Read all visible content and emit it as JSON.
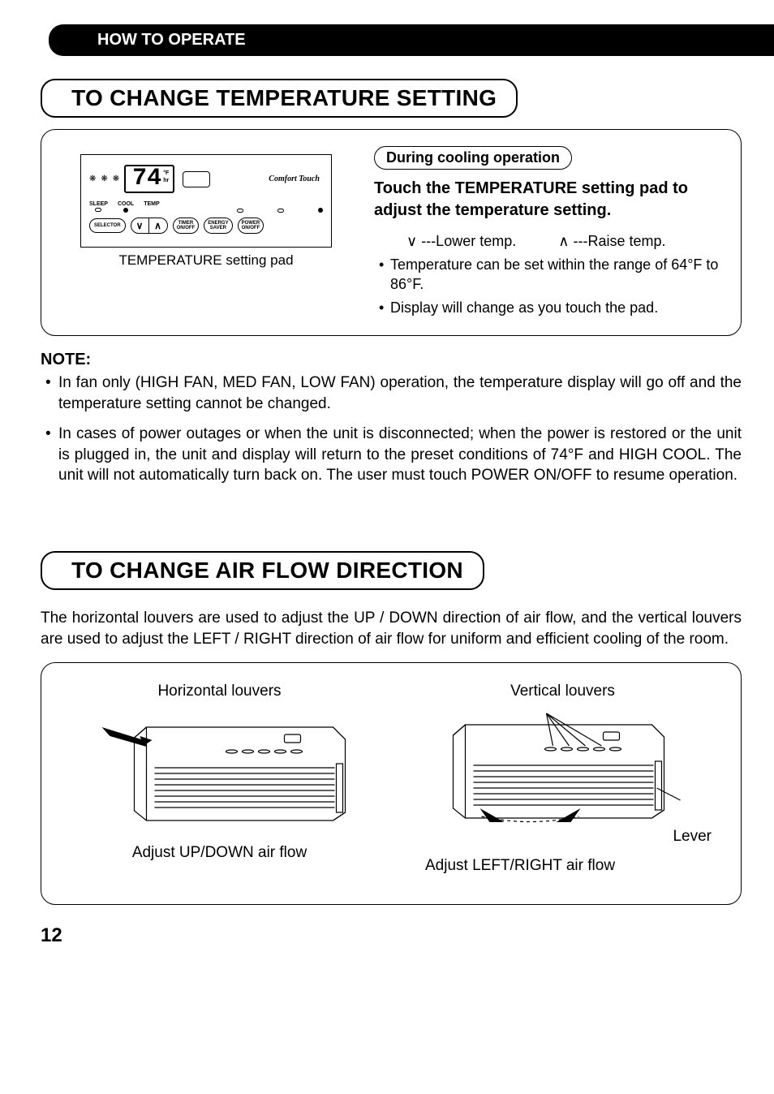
{
  "header": {
    "title": "HOW TO OPERATE"
  },
  "section1": {
    "title": "TO CHANGE TEMPERATURE SETTING",
    "diagram": {
      "display_value": "74",
      "display_unit_f": "°F",
      "display_unit_hr": "hr",
      "brand": "Comfort Touch",
      "leds": {
        "sleep": "SLEEP",
        "cool": "COOL",
        "temp": "TEMP"
      },
      "buttons": {
        "selector": "SELECTOR",
        "down": "∨",
        "up": "∧",
        "timer": "TIMER",
        "timer_sub": "ON/OFF",
        "energy": "ENERGY",
        "energy_sub": "SAVER",
        "power": "POWER",
        "power_sub": "ON/OFF"
      },
      "caption": "TEMPERATURE setting pad"
    },
    "badge": "During cooling operation",
    "instruction": "Touch the TEMPERATURE setting pad to adjust the temperature setting.",
    "arrows": {
      "down_sym": "∨",
      "down_text": "---Lower temp.",
      "up_sym": "∧",
      "up_text": "---Raise temp."
    },
    "bullets": [
      "Temperature can be set within the range of 64°F to 86°F.",
      "Display will change as you touch the pad."
    ],
    "note_heading": "NOTE:",
    "notes": [
      "In fan only (HIGH FAN, MED FAN, LOW FAN) operation, the temperature display will go off and the temperature setting cannot be changed.",
      "In cases of power outages or when the unit is disconnected; when the power is restored or the unit is plugged in, the unit and display will return to the preset conditions of 74°F and HIGH COOL. The unit will not automatically turn back on.  The user must touch POWER ON/OFF to resume operation."
    ]
  },
  "section2": {
    "title": "TO CHANGE AIR FLOW DIRECTION",
    "intro": "The horizontal louvers are used to adjust the UP / DOWN direction of air flow, and the vertical louvers are used to adjust the LEFT / RIGHT direction of air flow for uniform and efficient  cooling of  the  room.",
    "left": {
      "top": "Horizontal louvers",
      "bottom": "Adjust UP/DOWN air flow"
    },
    "right": {
      "top": "Vertical louvers",
      "lever": "Lever",
      "bottom": "Adjust LEFT/RIGHT air flow"
    }
  },
  "page_number": "12"
}
